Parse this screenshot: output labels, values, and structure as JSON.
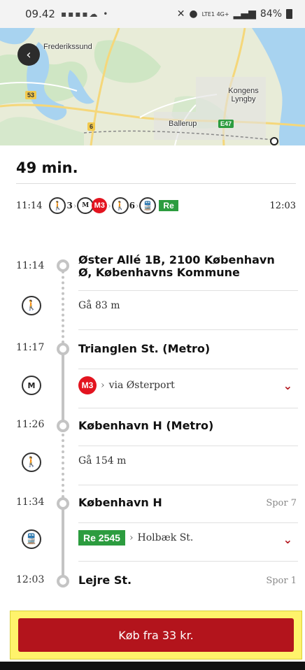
{
  "status_bar": {
    "time": "09.42",
    "notifications": "▪▪▪▪☁ •",
    "signal": "LTE1 4G+",
    "battery": "84%"
  },
  "map": {
    "labels": [
      "Frederikssund",
      "Kongens Lyngby",
      "Ballerup"
    ],
    "road_badges": [
      "53",
      "6",
      "E47"
    ]
  },
  "journey": {
    "duration": "49 min.",
    "summary": {
      "start_time": "11:14",
      "end_time": "12:03",
      "walk1_count": "3",
      "metro_line": "M3",
      "walk2_count": "6",
      "train_line": "Re"
    }
  },
  "timeline": {
    "stops": [
      {
        "time": "11:14",
        "name": "Øster Allé 1B, 2100 København Ø, Københavns Kommune",
        "track": ""
      },
      {
        "time": "11:17",
        "name": "Trianglen St. (Metro)",
        "track": ""
      },
      {
        "time": "11:26",
        "name": "København H (Metro)",
        "track": ""
      },
      {
        "time": "11:34",
        "name": "København H",
        "track": "Spor 7"
      },
      {
        "time": "12:03",
        "name": "Lejre St.",
        "track": "Spor 1"
      }
    ],
    "legs": [
      {
        "mode": "walk",
        "text": "Gå 83 m"
      },
      {
        "mode": "metro",
        "line": "M3",
        "text": "via Østerport"
      },
      {
        "mode": "walk",
        "text": "Gå 154 m"
      },
      {
        "mode": "train",
        "line": "Re 2545",
        "text": "Holbæk St."
      }
    ]
  },
  "buy": {
    "label": "Køb fra 33 kr."
  },
  "colors": {
    "accent_red": "#b3141c",
    "metro_red": "#e3141f",
    "regional_green": "#2c9c3f",
    "buy_highlight": "#fff36b"
  }
}
